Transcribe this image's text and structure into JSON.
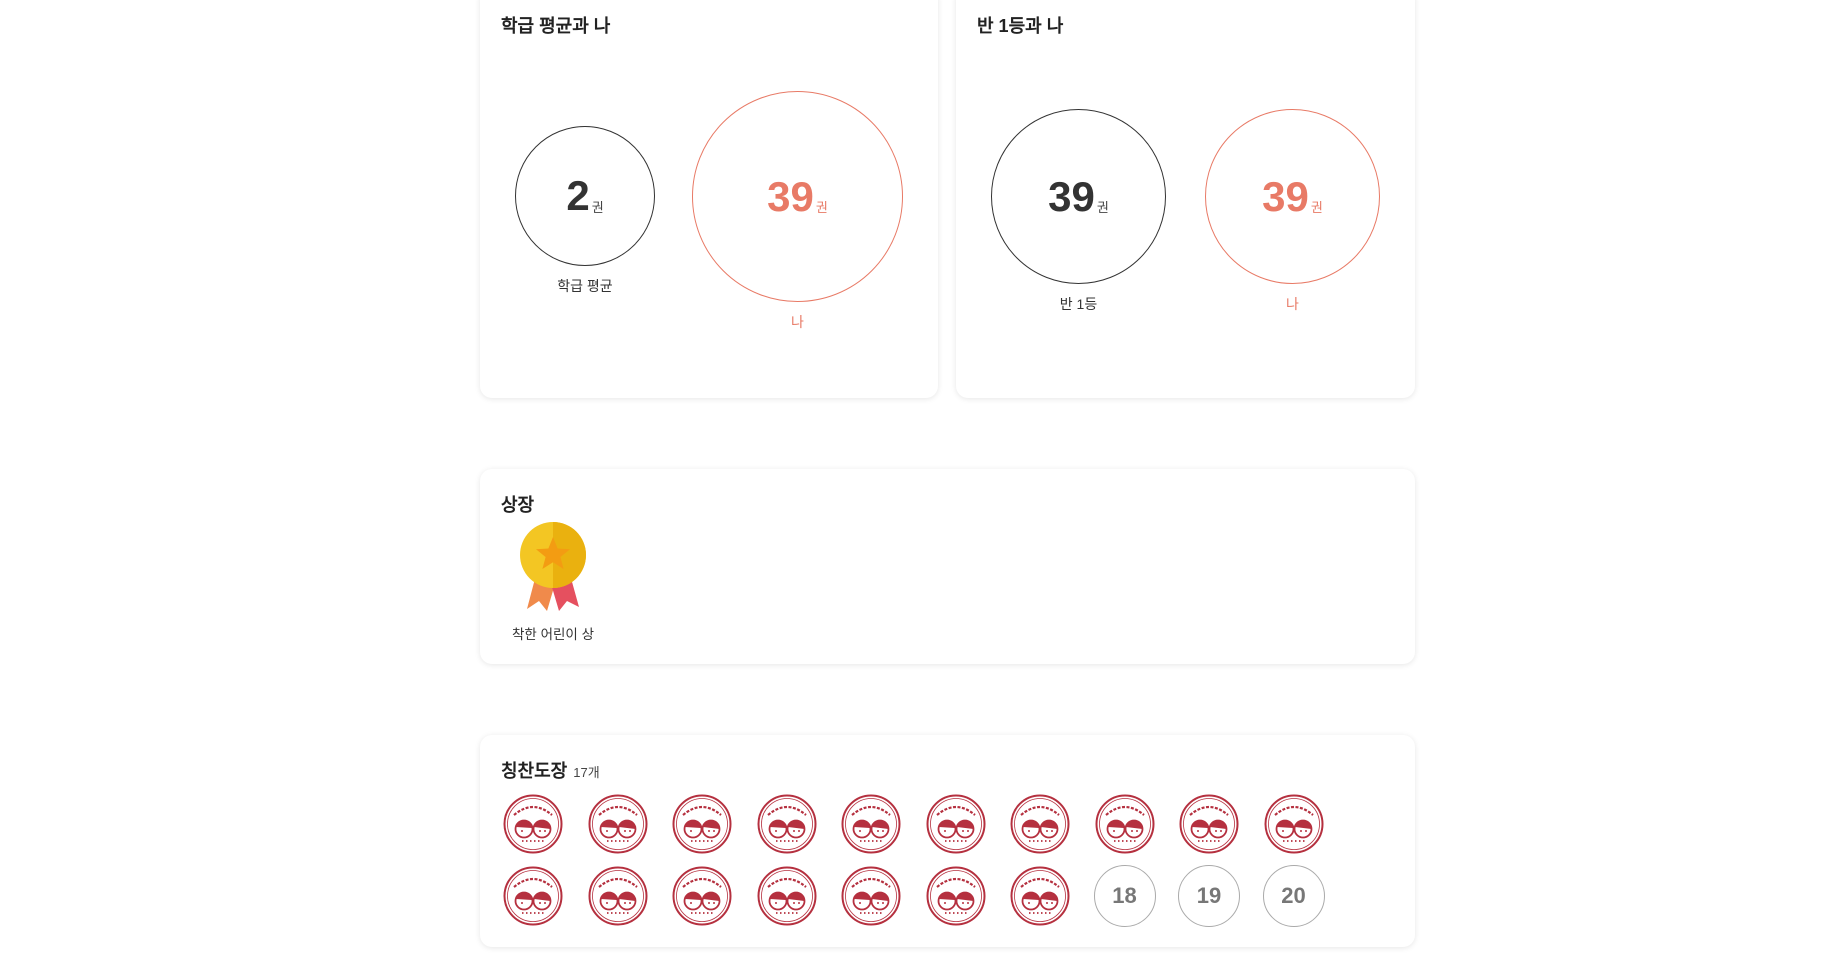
{
  "class_avg_card": {
    "title": "학급 평균과 나",
    "avg": {
      "value": "2",
      "unit": "권",
      "label": "학급 평균"
    },
    "me": {
      "value": "39",
      "unit": "권",
      "label": "나"
    }
  },
  "class_top_card": {
    "title": "반 1등과 나",
    "top": {
      "value": "39",
      "unit": "권",
      "label": "반 1등"
    },
    "me": {
      "value": "39",
      "unit": "권",
      "label": "나"
    }
  },
  "awards_card": {
    "title": "상장",
    "awards": [
      {
        "label": "착한 어린이 상",
        "icon": "medal-icon"
      }
    ]
  },
  "stamps_card": {
    "title": "칭찬도장",
    "count": "17개",
    "earned": 17,
    "slots": [
      "18",
      "19",
      "20"
    ],
    "stamp_icon": "praise-stamp-icon"
  },
  "colors": {
    "accent": "#e87a66",
    "stamp": "#b5303f",
    "medal_gold": "#f3c623",
    "ribbon_orange": "#f08a4b",
    "ribbon_red": "#e5505f"
  }
}
